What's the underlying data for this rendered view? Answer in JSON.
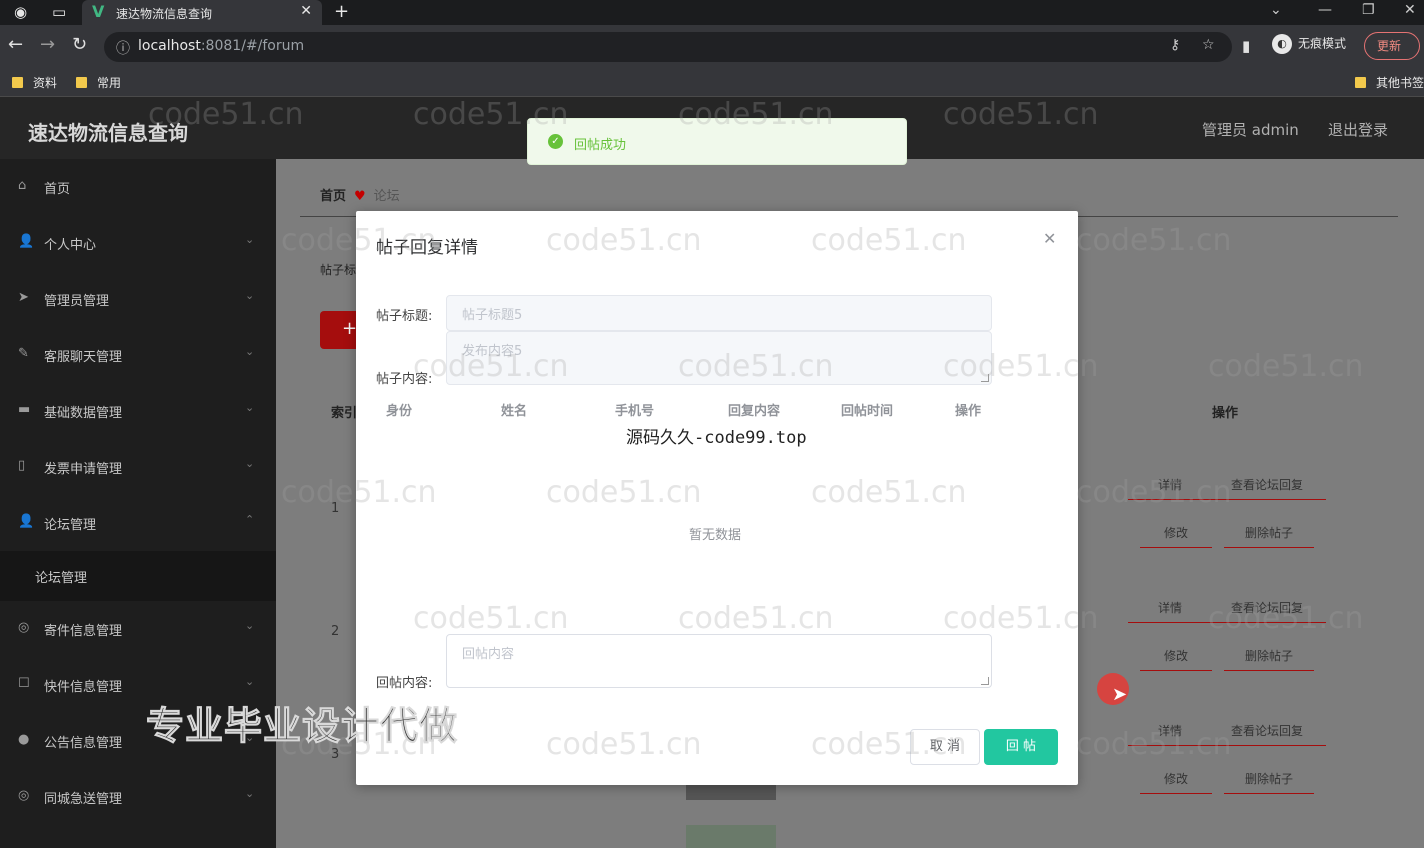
{
  "browser": {
    "tab_title": "速达物流信息查询",
    "url_host": "localhost",
    "url_rest": ":8081/#/forum",
    "incognito_label": "无痕模式",
    "update_label": "更新",
    "bookmarks": [
      "资料",
      "常用"
    ],
    "other_bookmarks": "其他书签"
  },
  "header": {
    "app_title": "速达物流信息查询",
    "user": "管理员 admin",
    "logout": "退出登录"
  },
  "sidebar": {
    "items": [
      {
        "label": "首页",
        "icon": "home-icon"
      },
      {
        "label": "个人中心",
        "icon": "user-icon"
      },
      {
        "label": "管理员管理",
        "icon": "send-icon"
      },
      {
        "label": "客服聊天管理",
        "icon": "edit-icon"
      },
      {
        "label": "基础数据管理",
        "icon": "monitor-icon"
      },
      {
        "label": "发票申请管理",
        "icon": "phone-icon"
      },
      {
        "label": "论坛管理",
        "icon": "user-icon"
      },
      {
        "label": "寄件信息管理",
        "icon": "globe-icon"
      },
      {
        "label": "快件信息管理",
        "icon": "box-icon"
      },
      {
        "label": "公告信息管理",
        "icon": "pin-icon"
      },
      {
        "label": "同城急送管理",
        "icon": "globe-icon"
      }
    ],
    "submenu": "论坛管理"
  },
  "main": {
    "breadcrumb_home": "首页",
    "breadcrumb_current": "论坛",
    "search_label": "帖子标",
    "add_label": "+",
    "th_index": "索引",
    "th_ops": "操作",
    "rows": [
      "1",
      "2",
      "3"
    ],
    "ops": {
      "detail": "详情",
      "view_reply": "查看论坛回复",
      "edit": "修改",
      "delete": "删除帖子"
    }
  },
  "toast": {
    "message": "回帖成功"
  },
  "dialog": {
    "title": "帖子回复详情",
    "post_title_label": "帖子标题:",
    "post_title_value": "帖子标题5",
    "post_content_label": "帖子内容:",
    "post_content_value": "发布内容5",
    "columns": [
      "身份",
      "姓名",
      "手机号",
      "回复内容",
      "回帖时间",
      "操作"
    ],
    "overlay_text": "源码久久-code99.top",
    "empty_text": "暂无数据",
    "reply_label": "回帖内容:",
    "reply_placeholder": "回帖内容",
    "cancel": "取 消",
    "submit": "回 帖"
  },
  "watermark": "code51.cn",
  "promo": "专业毕业设计代做"
}
